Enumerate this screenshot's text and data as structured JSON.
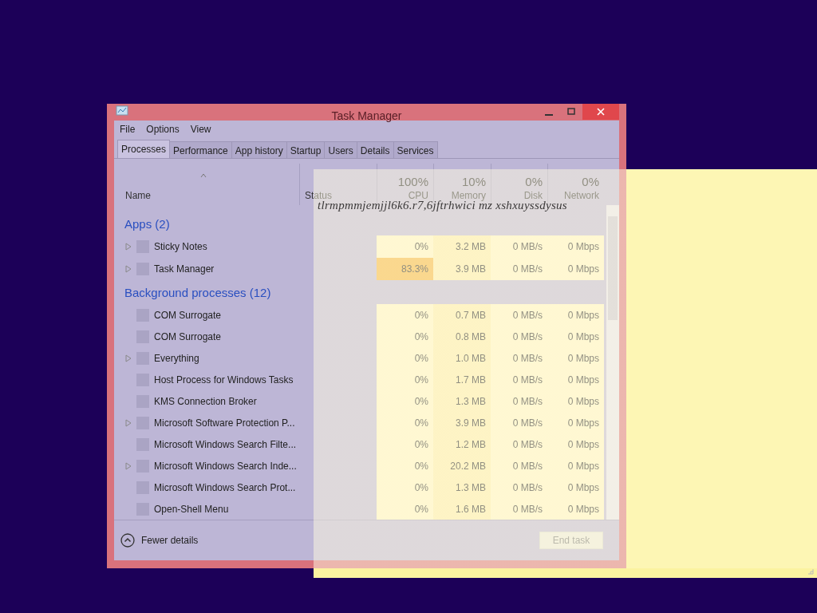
{
  "window": {
    "title": "Task Manager"
  },
  "menu": [
    "File",
    "Options",
    "View"
  ],
  "tabs": [
    {
      "label": "Processes",
      "selected": true
    },
    {
      "label": "Performance",
      "selected": false
    },
    {
      "label": "App history",
      "selected": false
    },
    {
      "label": "Startup",
      "selected": false
    },
    {
      "label": "Users",
      "selected": false
    },
    {
      "label": "Details",
      "selected": false
    },
    {
      "label": "Services",
      "selected": false
    }
  ],
  "columns": [
    {
      "label": "Name"
    },
    {
      "label": "Status"
    },
    {
      "label": "CPU",
      "total": "100%"
    },
    {
      "label": "Memory",
      "total": "10%"
    },
    {
      "label": "Disk",
      "total": "0%"
    },
    {
      "label": "Network",
      "total": "0%"
    }
  ],
  "groups": [
    {
      "title": "Apps (2)",
      "rows": [
        {
          "name": "Sticky Notes",
          "expandable": true,
          "cpu": "0%",
          "cpu_high": false,
          "memory": "3.2 MB",
          "disk": "0 MB/s",
          "network": "0 Mbps"
        },
        {
          "name": "Task Manager",
          "expandable": true,
          "cpu": "83.3%",
          "cpu_high": true,
          "memory": "3.9 MB",
          "disk": "0 MB/s",
          "network": "0 Mbps"
        }
      ]
    },
    {
      "title": "Background processes (12)",
      "rows": [
        {
          "name": "COM Surrogate",
          "expandable": false,
          "cpu": "0%",
          "cpu_high": false,
          "memory": "0.7 MB",
          "disk": "0 MB/s",
          "network": "0 Mbps"
        },
        {
          "name": "COM Surrogate",
          "expandable": false,
          "cpu": "0%",
          "cpu_high": false,
          "memory": "0.8 MB",
          "disk": "0 MB/s",
          "network": "0 Mbps"
        },
        {
          "name": "Everything",
          "expandable": true,
          "cpu": "0%",
          "cpu_high": false,
          "memory": "1.0 MB",
          "disk": "0 MB/s",
          "network": "0 Mbps"
        },
        {
          "name": "Host Process for Windows Tasks",
          "expandable": false,
          "cpu": "0%",
          "cpu_high": false,
          "memory": "1.7 MB",
          "disk": "0 MB/s",
          "network": "0 Mbps"
        },
        {
          "name": "KMS Connection Broker",
          "expandable": false,
          "cpu": "0%",
          "cpu_high": false,
          "memory": "1.3 MB",
          "disk": "0 MB/s",
          "network": "0 Mbps"
        },
        {
          "name": "Microsoft Software Protection P...",
          "expandable": true,
          "cpu": "0%",
          "cpu_high": false,
          "memory": "3.9 MB",
          "disk": "0 MB/s",
          "network": "0 Mbps"
        },
        {
          "name": "Microsoft Windows Search Filte...",
          "expandable": false,
          "cpu": "0%",
          "cpu_high": false,
          "memory": "1.2 MB",
          "disk": "0 MB/s",
          "network": "0 Mbps"
        },
        {
          "name": "Microsoft Windows Search Inde...",
          "expandable": true,
          "cpu": "0%",
          "cpu_high": false,
          "memory": "20.2 MB",
          "disk": "0 MB/s",
          "network": "0 Mbps"
        },
        {
          "name": "Microsoft Windows Search Prot...",
          "expandable": false,
          "cpu": "0%",
          "cpu_high": false,
          "memory": "1.3 MB",
          "disk": "0 MB/s",
          "network": "0 Mbps"
        },
        {
          "name": "Open-Shell Menu",
          "expandable": false,
          "cpu": "0%",
          "cpu_high": false,
          "memory": "1.6 MB",
          "disk": "0 MB/s",
          "network": "0 Mbps"
        }
      ]
    }
  ],
  "footer": {
    "details_link": "Fewer details",
    "end_task": {
      "label": "End task",
      "disabled": true
    }
  },
  "sticky_note": {
    "text": "tlrmpmmjemjjl6k6.r7,6jftrhwici mz xshxuyssdysus"
  }
}
